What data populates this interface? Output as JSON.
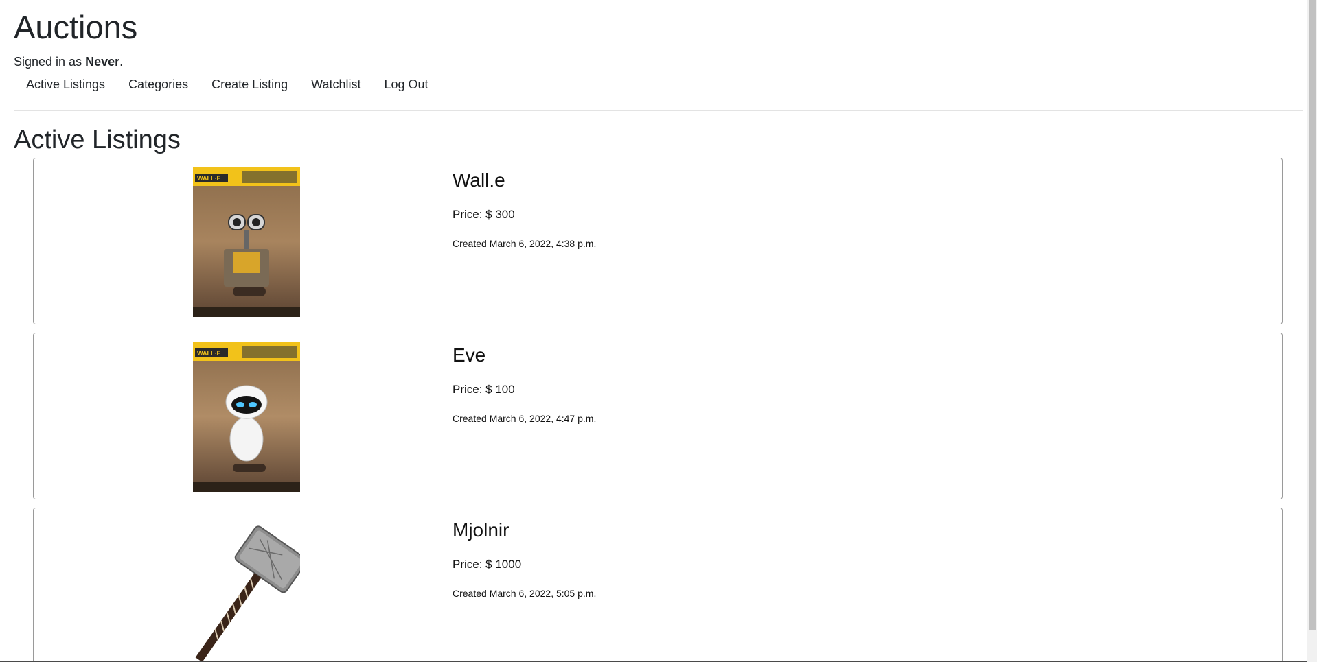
{
  "site": {
    "title": "Auctions",
    "signed_in_prefix": "Signed in as ",
    "username": "Never",
    "signed_in_suffix": "."
  },
  "nav": {
    "items": [
      {
        "label": "Active Listings"
      },
      {
        "label": "Categories"
      },
      {
        "label": "Create Listing"
      },
      {
        "label": "Watchlist"
      },
      {
        "label": "Log Out"
      }
    ]
  },
  "main": {
    "heading": "Active Listings",
    "listings": [
      {
        "name": "Wall.e",
        "price": "Price: $ 300",
        "created": "Created March 6, 2022, 4:38 p.m.",
        "image": "walle-figure-box"
      },
      {
        "name": "Eve",
        "price": "Price: $ 100",
        "created": "Created March 6, 2022, 4:47 p.m.",
        "image": "eve-figure-box"
      },
      {
        "name": "Mjolnir",
        "price": "Price: $ 1000",
        "created": "Created March 6, 2022, 5:05 p.m.",
        "image": "mjolnir-hammer"
      }
    ]
  },
  "colors": {
    "text": "#212529",
    "border": "#9a9a9a",
    "box_yellow": "#f2c21a"
  }
}
